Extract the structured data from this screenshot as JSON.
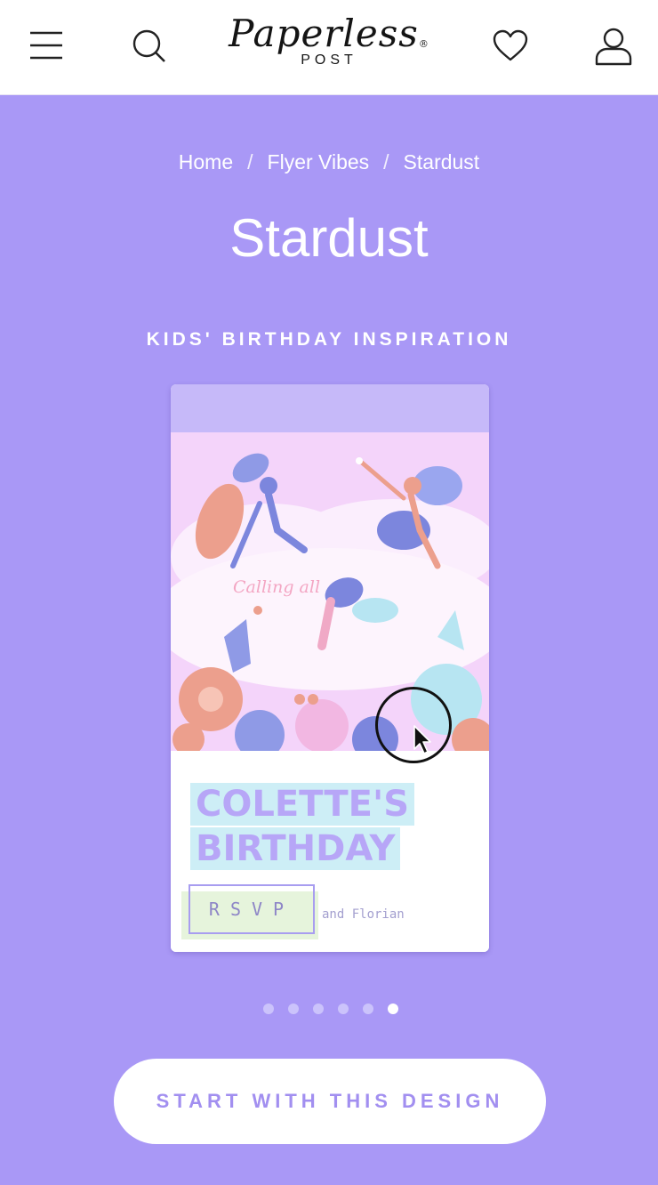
{
  "header": {
    "logo_script": "Paperless",
    "logo_reg": "®",
    "logo_sub": "POST",
    "icons": [
      "menu-icon",
      "search-icon",
      "heart-icon",
      "user-icon"
    ]
  },
  "breadcrumb": {
    "items": [
      "Home",
      "Flyer Vibes",
      "Stardust"
    ],
    "separator": "/"
  },
  "page": {
    "title": "Stardust",
    "section_label": "KIDS' BIRTHDAY INSPIRATION"
  },
  "card": {
    "script_text": "Calling all",
    "heading_line1": "COLETTE'S",
    "heading_line2": "BIRTHDAY",
    "rsvp": "RSVP",
    "and_text": "and Florian"
  },
  "carousel": {
    "dot_count": 6,
    "active_index": 5
  },
  "cta": {
    "label": "START WITH THIS DESIGN"
  },
  "colors": {
    "background": "#a998f6",
    "header": "#ffffff",
    "accent_text": "#a28ff0"
  }
}
